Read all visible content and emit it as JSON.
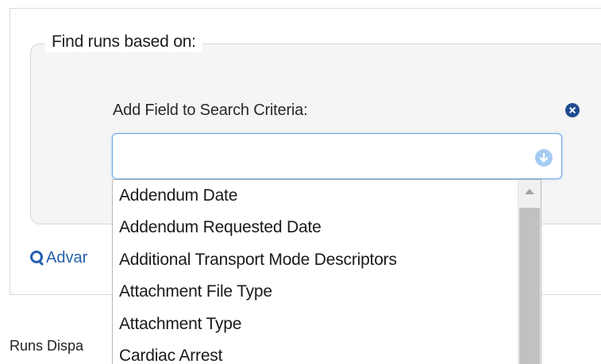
{
  "search_panel": {
    "legend": "Find runs based on:",
    "field_label": "Add Field to Search Criteria:",
    "select_value": "",
    "advanced_link": "Advar"
  },
  "dropdown": {
    "options": [
      "Addendum Date",
      "Addendum Requested Date",
      "Additional Transport Mode Descriptors",
      "Attachment File Type",
      "Attachment Type",
      "Cardiac Arrest"
    ]
  },
  "footer": {
    "runs_label": "Runs Dispa"
  },
  "colors": {
    "accent": "#2460b0",
    "remove_icon": "#1d4c8f",
    "select_border": "#69a6e6",
    "arrow_bg": "#a4ccf3"
  },
  "icons": [
    "remove-circle-icon",
    "chevron-down-circle-icon",
    "search-icon",
    "scroll-up-arrow-icon"
  ]
}
